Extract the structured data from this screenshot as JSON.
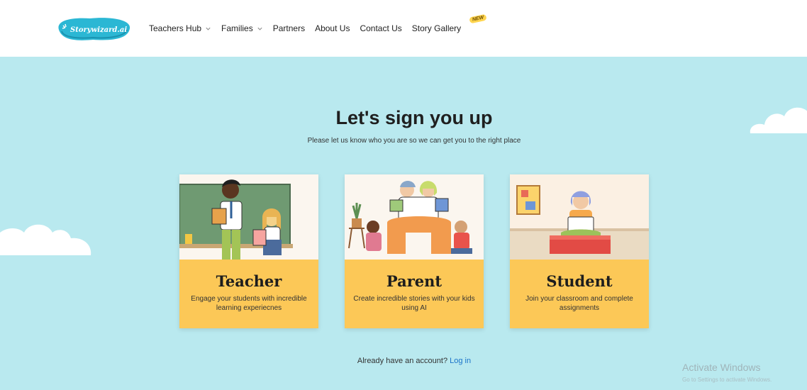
{
  "header": {
    "logo_text": "Storywizard.ai",
    "nav": [
      {
        "label": "Teachers Hub",
        "has_dropdown": true
      },
      {
        "label": "Families",
        "has_dropdown": true
      },
      {
        "label": "Partners",
        "has_dropdown": false
      },
      {
        "label": "About Us",
        "has_dropdown": false
      },
      {
        "label": "Contact Us",
        "has_dropdown": false
      },
      {
        "label": "Story Gallery",
        "has_dropdown": false
      }
    ],
    "new_badge": "NEW"
  },
  "main": {
    "title": "Let's sign you up",
    "subtitle": "Please let us know who you are so we can get you to the right place",
    "cards": [
      {
        "title": "Teacher",
        "description": "Engage your students with incredible learning experiecnes",
        "illustration": "teacher-illustration"
      },
      {
        "title": "Parent",
        "description": "Create incredible stories with your kids using AI",
        "illustration": "parent-illustration"
      },
      {
        "title": "Student",
        "description": "Join your classroom and complete assignments",
        "illustration": "student-illustration"
      }
    ],
    "login_prompt": "Already have an account?",
    "login_link": "Log in"
  },
  "watermark": {
    "title": "Activate Windows",
    "subtitle": "Go to Settings to activate Windows."
  },
  "colors": {
    "background": "#b9e9ef",
    "card_panel": "#fcc857",
    "logo_blue": "#2bb7d4",
    "link": "#1a73c9"
  }
}
